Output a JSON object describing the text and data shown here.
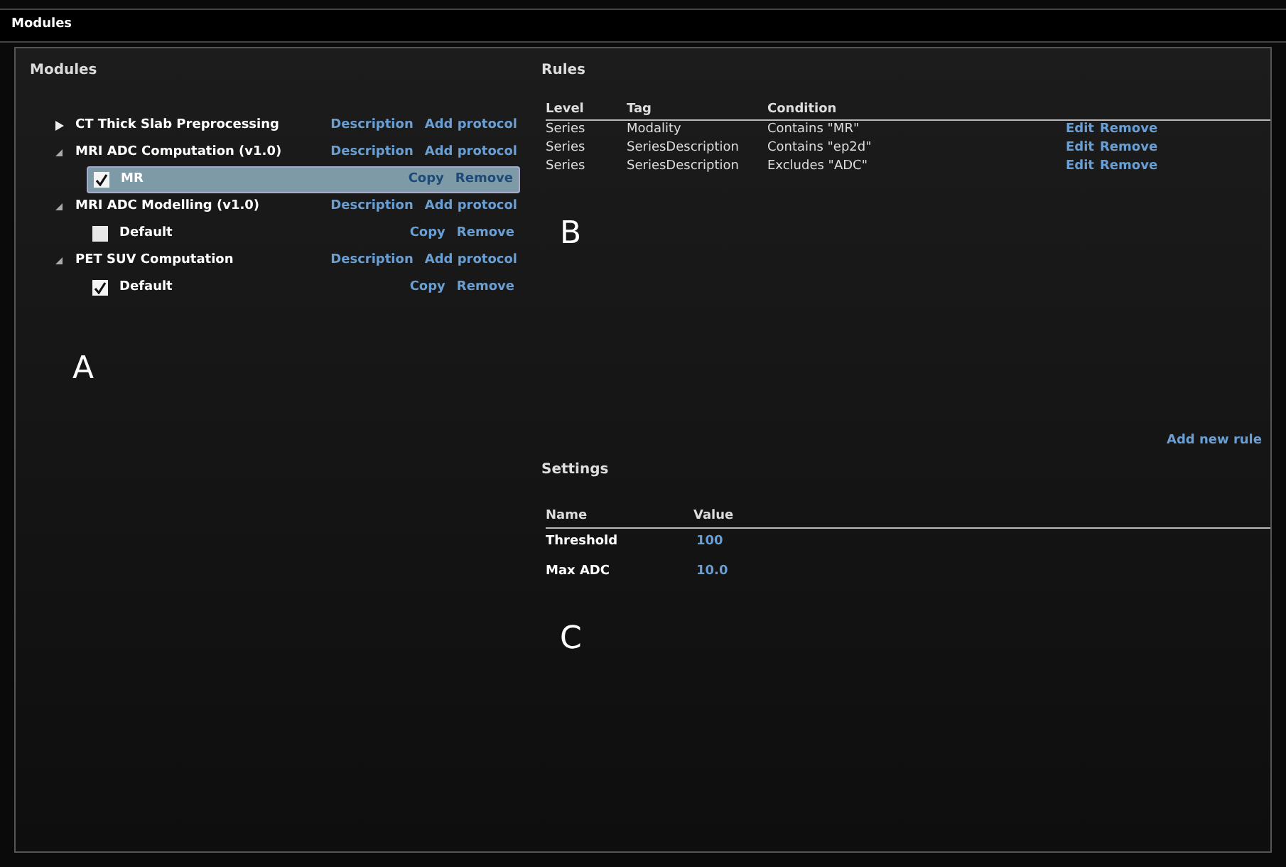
{
  "window": {
    "title": "Modules"
  },
  "modules_panel": {
    "title": "Modules",
    "modules": [
      {
        "name": "CT Thick Slab Preprocessing",
        "expanded": false,
        "links": [
          "Description",
          "Add protocol"
        ]
      },
      {
        "name": "MRI ADC Computation (v1.0)",
        "expanded": true,
        "links": [
          "Description",
          "Add protocol"
        ],
        "children": [
          {
            "name": "MR",
            "checked": true,
            "selected": true,
            "links": [
              "Copy",
              "Remove"
            ]
          }
        ]
      },
      {
        "name": "MRI ADC Modelling (v1.0)",
        "expanded": true,
        "links": [
          "Description",
          "Add protocol"
        ],
        "children": [
          {
            "name": "Default",
            "checked": false,
            "selected": false,
            "links": [
              "Copy",
              "Remove"
            ]
          }
        ]
      },
      {
        "name": "PET SUV Computation",
        "expanded": true,
        "links": [
          "Description",
          "Add protocol"
        ],
        "children": [
          {
            "name": "Default",
            "checked": true,
            "selected": false,
            "links": [
              "Copy",
              "Remove"
            ]
          }
        ]
      }
    ]
  },
  "rules": {
    "title": "Rules",
    "columns": [
      "Level",
      "Tag",
      "Condition"
    ],
    "rows": [
      {
        "cells": [
          "Series",
          "Modality",
          "Contains \"MR\""
        ],
        "actions": [
          "Edit",
          "Remove"
        ]
      },
      {
        "cells": [
          "Series",
          "SeriesDescription",
          "Contains \"ep2d\""
        ],
        "actions": [
          "Edit",
          "Remove"
        ]
      },
      {
        "cells": [
          "Series",
          "SeriesDescription",
          "Excludes \"ADC\""
        ],
        "actions": [
          "Edit",
          "Remove"
        ]
      }
    ],
    "add_link": "Add new rule"
  },
  "settings": {
    "title": "Settings",
    "columns": [
      "Name",
      "Value"
    ],
    "rows": [
      {
        "name": "Threshold",
        "value": "100"
      },
      {
        "name": "Max ADC",
        "value": "10.0"
      }
    ]
  },
  "annotations": [
    "A",
    "B",
    "C"
  ]
}
